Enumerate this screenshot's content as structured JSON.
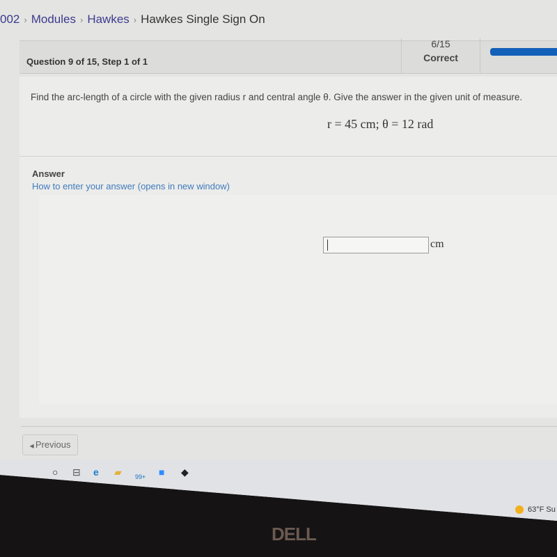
{
  "breadcrumb": {
    "items": [
      "002",
      "Modules",
      "Hawkes"
    ],
    "current": "Hawkes Single Sign On"
  },
  "header": {
    "question_label": "Question 9 of 15, Step 1 of 1",
    "score": "6/15",
    "score_status": "Correct",
    "progress_fraction": 0.4,
    "progress_color": "#1260b8"
  },
  "question": {
    "prompt": "Find the arc-length of a circle with the given radius r and central angle θ. Give the answer in the given unit of measure.",
    "given": "r = 45 cm; θ = 12 rad"
  },
  "answer": {
    "label": "Answer",
    "help_link": "How to enter your answer (opens in new window)",
    "value": "",
    "unit": "cm"
  },
  "nav": {
    "previous_label": "Previous"
  },
  "taskbar": {
    "icons": [
      "search-icon",
      "task-view-icon",
      "edge-icon",
      "file-explorer-icon",
      "mail-icon",
      "zoom-icon",
      "inkscape-icon"
    ],
    "mail_badge": "99+",
    "weather": "63°F Su"
  },
  "bezel": {
    "brand": "DELL"
  }
}
